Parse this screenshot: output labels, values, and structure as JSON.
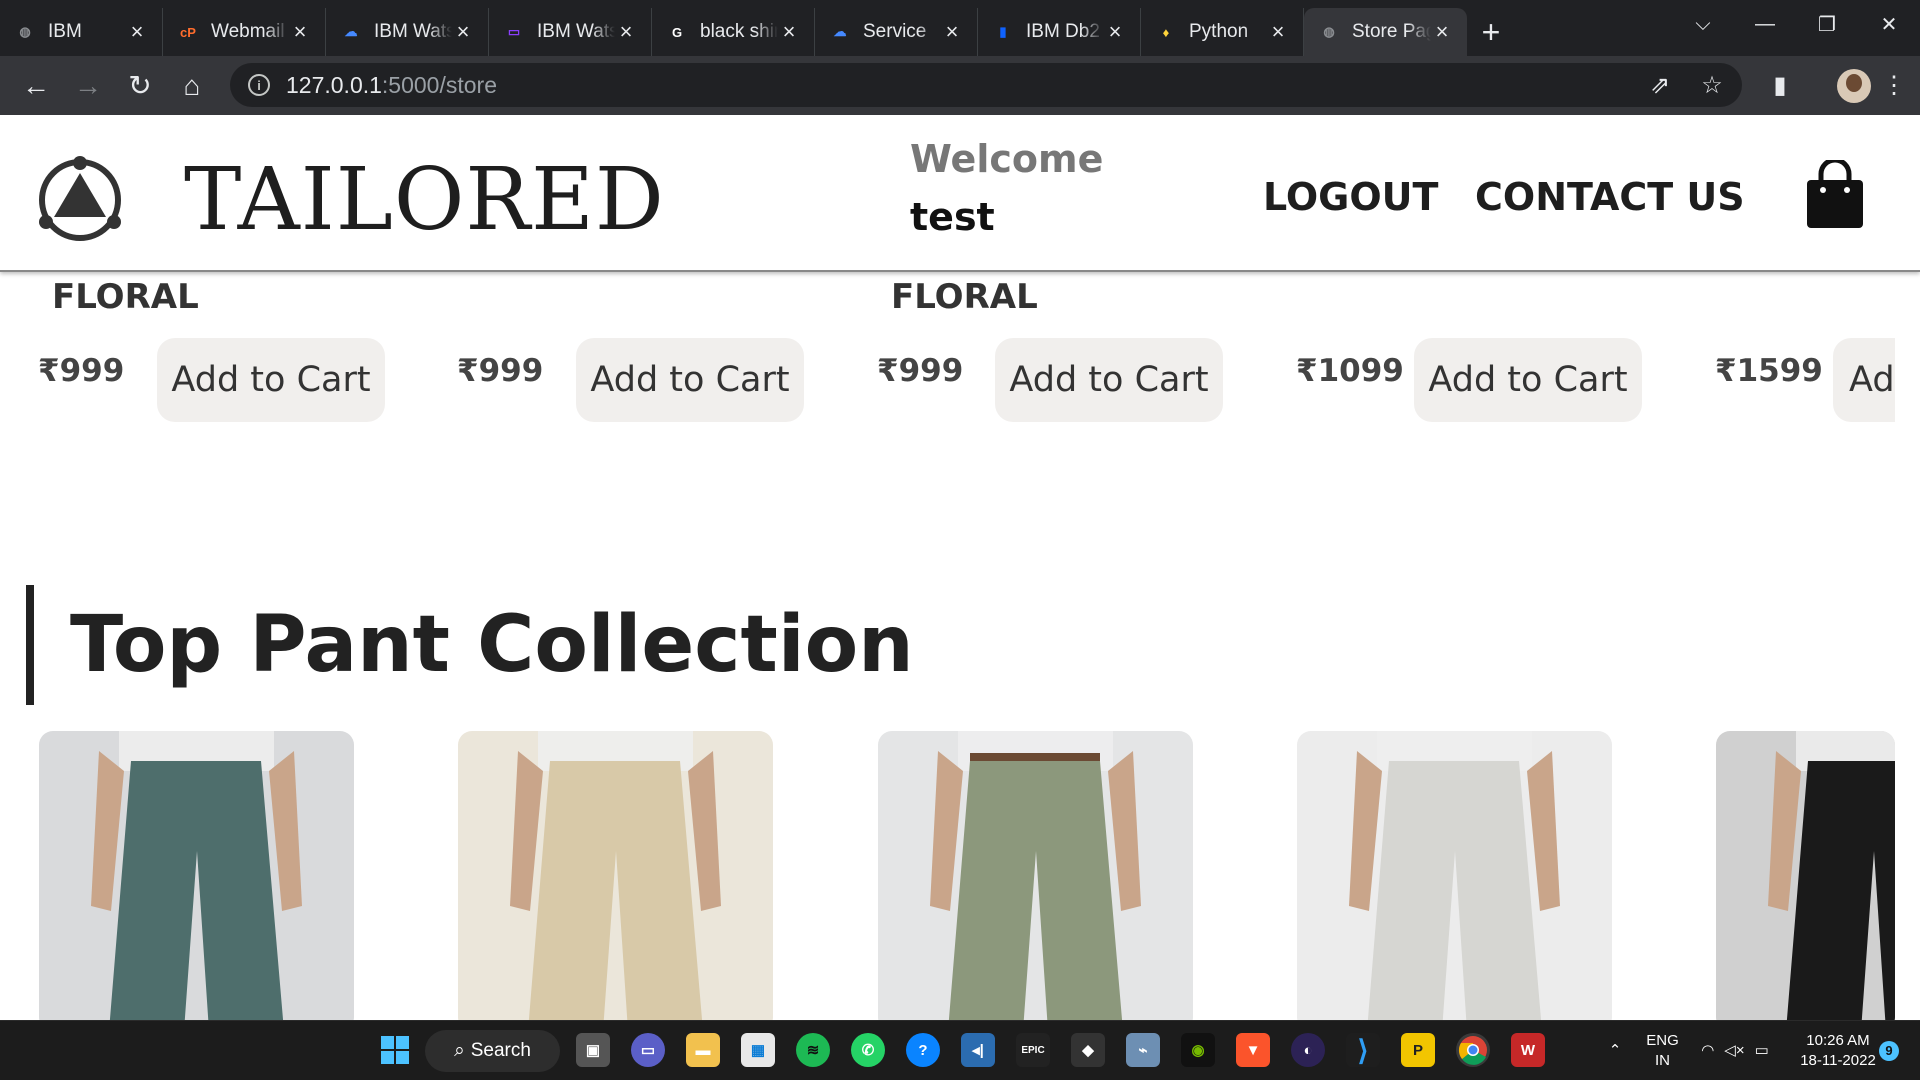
{
  "browser": {
    "tabs": [
      {
        "title": "IBM",
        "fav": "globe-icon",
        "color": "#8a8d91",
        "glyph": "◍"
      },
      {
        "title": "Webmail",
        "fav": "cpanel-icon",
        "color": "#ff6c2c",
        "glyph": "cP"
      },
      {
        "title": "IBM Watson",
        "fav": "ibm-cloud-icon",
        "color": "#4589ff",
        "glyph": "☁"
      },
      {
        "title": "IBM Watson Assistant",
        "fav": "chat-icon",
        "color": "#8a3ffc",
        "glyph": "▭"
      },
      {
        "title": "black shirt",
        "fav": "google-icon",
        "color": "#ffffff",
        "glyph": "G"
      },
      {
        "title": "Service",
        "fav": "ibm-cloud-icon",
        "color": "#4589ff",
        "glyph": "☁"
      },
      {
        "title": "IBM Db2",
        "fav": "bar-chart-icon",
        "color": "#0f62fe",
        "glyph": "▮"
      },
      {
        "title": "Python",
        "fav": "python-icon",
        "color": "#ffd43b",
        "glyph": "♦"
      },
      {
        "title": "Store Page",
        "fav": "globe-icon",
        "color": "#8a8d91",
        "glyph": "◍"
      }
    ],
    "url_host": "127.0.0.1",
    "url_path": ":5000/store"
  },
  "site": {
    "brand": "TAILORED",
    "welcome": "Welcome",
    "username": "test",
    "nav": {
      "logout": "LOGOUT",
      "contact": "CONTACT US"
    }
  },
  "shirts": {
    "categories": [
      "FLORAL",
      "FLORAL"
    ],
    "items": [
      {
        "price": "₹999",
        "button": "Add to Cart"
      },
      {
        "price": "₹999",
        "button": "Add to Cart"
      },
      {
        "price": "₹999",
        "button": "Add to Cart"
      },
      {
        "price": "₹1099",
        "button": "Add to Cart"
      },
      {
        "price": "₹1599",
        "button": "Add to Cart"
      }
    ]
  },
  "pants": {
    "title": "Top Pant Collection",
    "cards": [
      {
        "name": "pant-teal",
        "color": "#4e6e6c",
        "bg": "#d9dadc"
      },
      {
        "name": "pant-beige",
        "color": "#d8c9a8",
        "bg": "#ebe6da"
      },
      {
        "name": "pant-olive",
        "color": "#8c987c",
        "bg": "#e4e5e6"
      },
      {
        "name": "pant-light-grey",
        "color": "#d6d6d2",
        "bg": "#ececec"
      },
      {
        "name": "pant-black",
        "color": "#1a1a1a",
        "bg": "#d0d0d0"
      }
    ]
  },
  "taskbar": {
    "search_label": "Search",
    "language": "ENG",
    "region": "IN",
    "time": "10:26 AM",
    "date": "18-11-2022",
    "notifications": "9"
  }
}
